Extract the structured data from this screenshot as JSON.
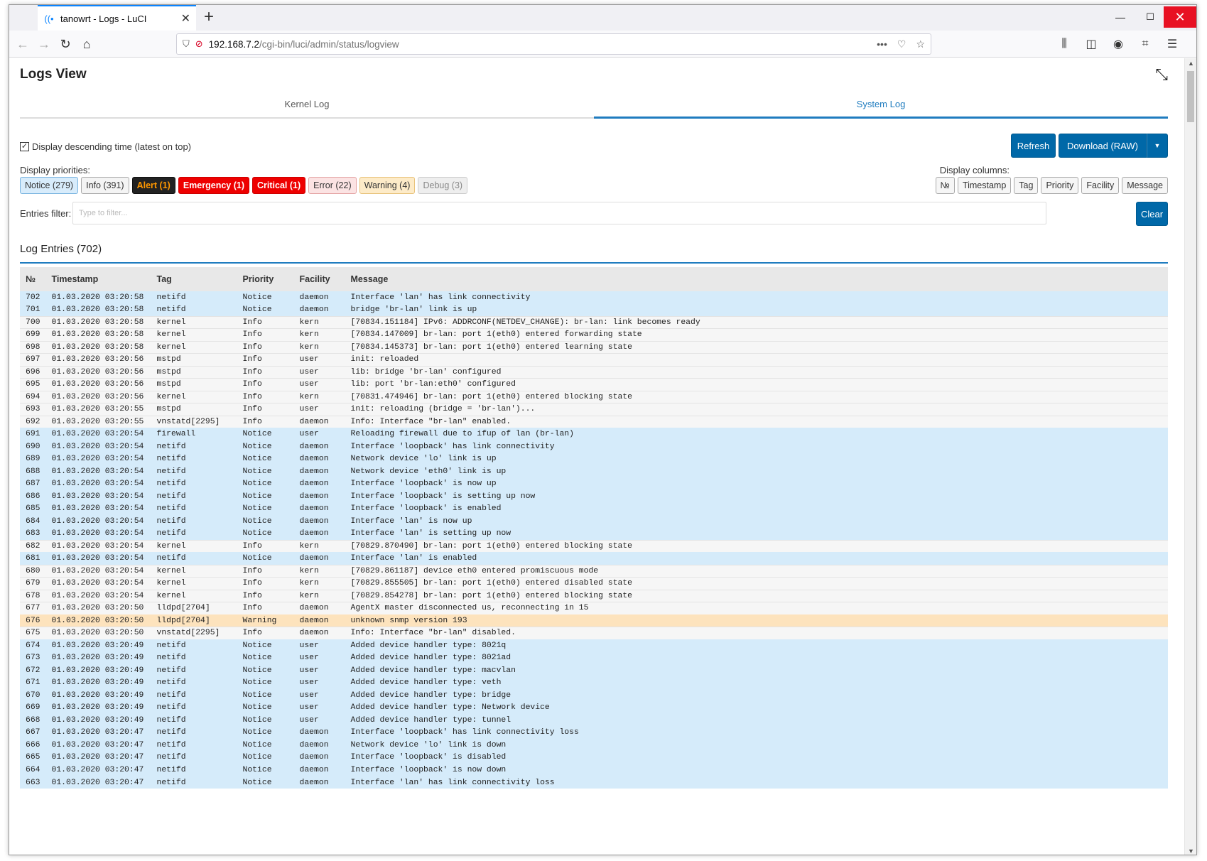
{
  "browser": {
    "tab_title": "tanowrt - Logs - LuCI",
    "url_host": "192.168.7.2",
    "url_path": "/cgi-bin/luci/admin/status/logview",
    "url_actions": "•••"
  },
  "page": {
    "title": "Logs View",
    "tabs": [
      {
        "label": "Kernel Log",
        "active": false
      },
      {
        "label": "System Log",
        "active": true
      }
    ],
    "descending_label": "Display descending time (latest on top)",
    "descending_checked": true,
    "refresh_label": "Refresh",
    "download_label": "Download (RAW)",
    "priorities_label": "Display priorities:",
    "priorities": [
      {
        "label": "Notice (279)",
        "class": "b-notice"
      },
      {
        "label": "Info (391)",
        "class": "b-info"
      },
      {
        "label": "Alert (1)",
        "class": "b-alert"
      },
      {
        "label": "Emergency (1)",
        "class": "b-emerg"
      },
      {
        "label": "Critical (1)",
        "class": "b-crit"
      },
      {
        "label": "Error (22)",
        "class": "b-error"
      },
      {
        "label": "Warning (4)",
        "class": "b-warn"
      },
      {
        "label": "Debug (3)",
        "class": "b-debug"
      }
    ],
    "columns_label": "Display columns:",
    "columns": [
      "№",
      "Timestamp",
      "Tag",
      "Priority",
      "Facility",
      "Message"
    ],
    "filter_label": "Entries filter:",
    "filter_placeholder": "Type to filter...",
    "clear_label": "Clear",
    "entries_title": "Log Entries (702)"
  },
  "colors": {
    "accent": "#1f7cbf",
    "primary_button": "#0068a8",
    "notice_row": "#d5ebfa",
    "warning_row": "#fde3bd",
    "info_row": "#f6f6f6"
  },
  "log": {
    "headers": [
      "№",
      "Timestamp",
      "Tag",
      "Priority",
      "Facility",
      "Message"
    ],
    "rows": [
      [
        "702",
        "01.03.2020 03:20:58",
        "netifd",
        "Notice",
        "daemon",
        "Interface 'lan' has link connectivity"
      ],
      [
        "701",
        "01.03.2020 03:20:58",
        "netifd",
        "Notice",
        "daemon",
        "bridge 'br-lan' link is up"
      ],
      [
        "700",
        "01.03.2020 03:20:58",
        "kernel",
        "Info",
        "kern",
        "[70834.151184] IPv6: ADDRCONF(NETDEV_CHANGE): br-lan: link becomes ready"
      ],
      [
        "699",
        "01.03.2020 03:20:58",
        "kernel",
        "Info",
        "kern",
        "[70834.147009] br-lan: port 1(eth0) entered forwarding state"
      ],
      [
        "698",
        "01.03.2020 03:20:58",
        "kernel",
        "Info",
        "kern",
        "[70834.145373] br-lan: port 1(eth0) entered learning state"
      ],
      [
        "697",
        "01.03.2020 03:20:56",
        "mstpd",
        "Info",
        "user",
        "init: reloaded"
      ],
      [
        "696",
        "01.03.2020 03:20:56",
        "mstpd",
        "Info",
        "user",
        "lib: bridge 'br-lan' configured"
      ],
      [
        "695",
        "01.03.2020 03:20:56",
        "mstpd",
        "Info",
        "user",
        "lib: port 'br-lan:eth0' configured"
      ],
      [
        "694",
        "01.03.2020 03:20:56",
        "kernel",
        "Info",
        "kern",
        "[70831.474946] br-lan: port 1(eth0) entered blocking state"
      ],
      [
        "693",
        "01.03.2020 03:20:55",
        "mstpd",
        "Info",
        "user",
        "init: reloading (bridge = 'br-lan')..."
      ],
      [
        "692",
        "01.03.2020 03:20:55",
        "vnstatd[2295]",
        "Info",
        "daemon",
        "Info: Interface \"br-lan\" enabled."
      ],
      [
        "691",
        "01.03.2020 03:20:54",
        "firewall",
        "Notice",
        "user",
        "Reloading firewall due to ifup of lan (br-lan)"
      ],
      [
        "690",
        "01.03.2020 03:20:54",
        "netifd",
        "Notice",
        "daemon",
        "Interface 'loopback' has link connectivity"
      ],
      [
        "689",
        "01.03.2020 03:20:54",
        "netifd",
        "Notice",
        "daemon",
        "Network device 'lo' link is up"
      ],
      [
        "688",
        "01.03.2020 03:20:54",
        "netifd",
        "Notice",
        "daemon",
        "Network device 'eth0' link is up"
      ],
      [
        "687",
        "01.03.2020 03:20:54",
        "netifd",
        "Notice",
        "daemon",
        "Interface 'loopback' is now up"
      ],
      [
        "686",
        "01.03.2020 03:20:54",
        "netifd",
        "Notice",
        "daemon",
        "Interface 'loopback' is setting up now"
      ],
      [
        "685",
        "01.03.2020 03:20:54",
        "netifd",
        "Notice",
        "daemon",
        "Interface 'loopback' is enabled"
      ],
      [
        "684",
        "01.03.2020 03:20:54",
        "netifd",
        "Notice",
        "daemon",
        "Interface 'lan' is now up"
      ],
      [
        "683",
        "01.03.2020 03:20:54",
        "netifd",
        "Notice",
        "daemon",
        "Interface 'lan' is setting up now"
      ],
      [
        "682",
        "01.03.2020 03:20:54",
        "kernel",
        "Info",
        "kern",
        "[70829.870490] br-lan: port 1(eth0) entered blocking state"
      ],
      [
        "681",
        "01.03.2020 03:20:54",
        "netifd",
        "Notice",
        "daemon",
        "Interface 'lan' is enabled"
      ],
      [
        "680",
        "01.03.2020 03:20:54",
        "kernel",
        "Info",
        "kern",
        "[70829.861187] device eth0 entered promiscuous mode"
      ],
      [
        "679",
        "01.03.2020 03:20:54",
        "kernel",
        "Info",
        "kern",
        "[70829.855505] br-lan: port 1(eth0) entered disabled state"
      ],
      [
        "678",
        "01.03.2020 03:20:54",
        "kernel",
        "Info",
        "kern",
        "[70829.854278] br-lan: port 1(eth0) entered blocking state"
      ],
      [
        "677",
        "01.03.2020 03:20:50",
        "lldpd[2704]",
        "Info",
        "daemon",
        "AgentX master disconnected us, reconnecting in 15"
      ],
      [
        "676",
        "01.03.2020 03:20:50",
        "lldpd[2704]",
        "Warning",
        "daemon",
        "unknown snmp version 193"
      ],
      [
        "675",
        "01.03.2020 03:20:50",
        "vnstatd[2295]",
        "Info",
        "daemon",
        "Info: Interface \"br-lan\" disabled."
      ],
      [
        "674",
        "01.03.2020 03:20:49",
        "netifd",
        "Notice",
        "user",
        "Added device handler type: 8021q"
      ],
      [
        "673",
        "01.03.2020 03:20:49",
        "netifd",
        "Notice",
        "user",
        "Added device handler type: 8021ad"
      ],
      [
        "672",
        "01.03.2020 03:20:49",
        "netifd",
        "Notice",
        "user",
        "Added device handler type: macvlan"
      ],
      [
        "671",
        "01.03.2020 03:20:49",
        "netifd",
        "Notice",
        "user",
        "Added device handler type: veth"
      ],
      [
        "670",
        "01.03.2020 03:20:49",
        "netifd",
        "Notice",
        "user",
        "Added device handler type: bridge"
      ],
      [
        "669",
        "01.03.2020 03:20:49",
        "netifd",
        "Notice",
        "user",
        "Added device handler type: Network device"
      ],
      [
        "668",
        "01.03.2020 03:20:49",
        "netifd",
        "Notice",
        "user",
        "Added device handler type: tunnel"
      ],
      [
        "667",
        "01.03.2020 03:20:47",
        "netifd",
        "Notice",
        "daemon",
        "Interface 'loopback' has link connectivity loss"
      ],
      [
        "666",
        "01.03.2020 03:20:47",
        "netifd",
        "Notice",
        "daemon",
        "Network device 'lo' link is down"
      ],
      [
        "665",
        "01.03.2020 03:20:47",
        "netifd",
        "Notice",
        "daemon",
        "Interface 'loopback' is disabled"
      ],
      [
        "664",
        "01.03.2020 03:20:47",
        "netifd",
        "Notice",
        "daemon",
        "Interface 'loopback' is now down"
      ],
      [
        "663",
        "01.03.2020 03:20:47",
        "netifd",
        "Notice",
        "daemon",
        "Interface 'lan' has link connectivity loss"
      ]
    ]
  }
}
